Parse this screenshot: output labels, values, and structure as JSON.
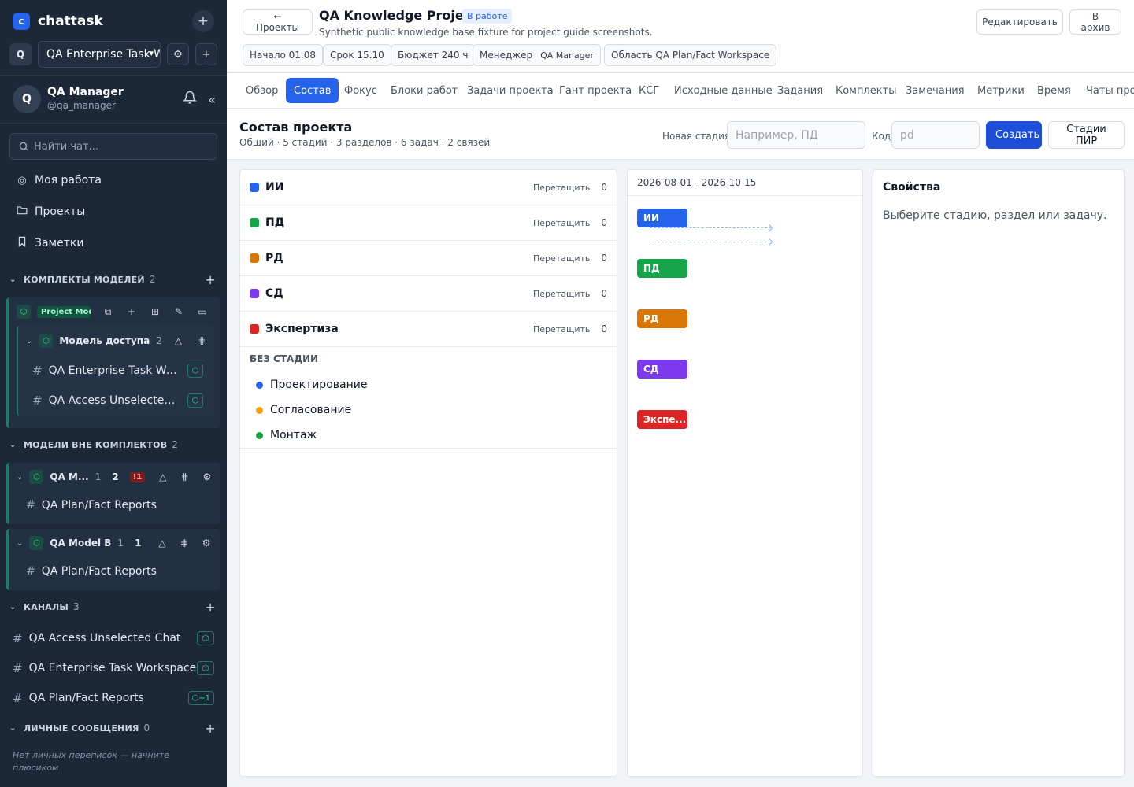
{
  "app": {
    "logo_letter": "c",
    "name": "chattask"
  },
  "workspace": {
    "letter": "Q",
    "selected": "QA Enterprise Task Workspace"
  },
  "user": {
    "initial": "Q",
    "name": "QA Manager",
    "handle": "@qa_manager"
  },
  "search": {
    "placeholder": "Найти чат..."
  },
  "nav": [
    {
      "label": "Моя работа",
      "icon": "target-icon"
    },
    {
      "label": "Проекты",
      "icon": "folder-icon"
    },
    {
      "label": "Заметки",
      "icon": "bookmark-icon"
    }
  ],
  "model_sets": {
    "title": "КОМПЛЕКТЫ МОДЕЛЕЙ",
    "count": "2",
    "set_badge": "Project Models",
    "model": {
      "name": "Модель доступа",
      "count": "2"
    },
    "channels": [
      {
        "label": "QA Enterprise Task Workspace"
      },
      {
        "label": "QA Access Unselected Chat"
      }
    ]
  },
  "models_outside": {
    "title": "МОДЕЛИ ВНЕ КОМПЛЕКТОВ",
    "count": "2",
    "models": [
      {
        "name": "QA M...",
        "n1": "1",
        "n2": "2",
        "warn": "!1",
        "channel": "QA Plan/Fact Reports"
      },
      {
        "name": "QA Model B",
        "n1": "1",
        "n2": "1",
        "warn": "",
        "channel": "QA Plan/Fact Reports"
      }
    ]
  },
  "channels_section": {
    "title": "КАНАЛЫ",
    "count": "3",
    "items": [
      {
        "label": "QA Access Unselected Chat",
        "tag": "⬡"
      },
      {
        "label": "QA Enterprise Task Workspace",
        "tag": "⬡"
      },
      {
        "label": "QA Plan/Fact Reports",
        "tag": "⬡+1"
      }
    ]
  },
  "dm_section": {
    "title": "ЛИЧНЫЕ СООБЩЕНИЯ",
    "count": "0",
    "empty": "Нет личных переписок — начните плюсиком"
  },
  "header": {
    "back": "← Проекты",
    "title": "QA Knowledge Project",
    "status": "В работе",
    "subtitle": "Synthetic public knowledge base fixture for project guide screenshots.",
    "edit": "Редактировать",
    "archive": "В архив",
    "chips": {
      "start": "Начало 01.08",
      "due": "Срок 15.10",
      "budget": "Бюджет 240 ч",
      "manager_label": "Менеджер",
      "manager_value": "QA Manager",
      "area": "Область QA Plan/Fact Workspace"
    }
  },
  "tabs": [
    "Обзор",
    "Состав",
    "Фокус",
    "Блоки работ",
    "Задачи проекта",
    "Гант проекта",
    "КСГ",
    "Исходные данные",
    "Задания",
    "Комплекты",
    "Замечания",
    "Метрики",
    "Время",
    "Чаты проекта"
  ],
  "active_tab": "Состав",
  "composition": {
    "title": "Состав проекта",
    "summary": "Общий · 5 стадий · 3 разделов · 6 задач · 2 связей",
    "new_stage_label": "Новая стадия",
    "new_stage_placeholder": "Например, ПД",
    "code_label": "Код",
    "code_placeholder": "pd",
    "create": "Создать",
    "pir_stages": "Стадии ПИР"
  },
  "stages": [
    {
      "name": "ИИ",
      "color": "#2563eb",
      "drag": "Перетащить",
      "count": "0"
    },
    {
      "name": "ПД",
      "color": "#16a34a",
      "drag": "Перетащить",
      "count": "0"
    },
    {
      "name": "РД",
      "color": "#d97706",
      "drag": "Перетащить",
      "count": "0"
    },
    {
      "name": "СД",
      "color": "#7c3aed",
      "drag": "Перетащить",
      "count": "0"
    },
    {
      "name": "Экспертиза",
      "color": "#dc2626",
      "drag": "Перетащить",
      "count": "0"
    }
  ],
  "no_stage": {
    "title": "БЕЗ СТАДИИ",
    "sections": [
      {
        "name": "Проектирование",
        "color": "#2563eb"
      },
      {
        "name": "Согласование",
        "color": "#f59e0b"
      },
      {
        "name": "Монтаж",
        "color": "#16a34a"
      }
    ]
  },
  "gantt": {
    "range": "2026-08-01 - 2026-10-15",
    "bars": [
      {
        "label": "ИИ",
        "color": "#2563eb"
      },
      {
        "label": "ПД",
        "color": "#16a34a"
      },
      {
        "label": "РД",
        "color": "#d97706"
      },
      {
        "label": "СД",
        "color": "#7c3aed"
      },
      {
        "label": "Экспе...",
        "color": "#dc2626"
      }
    ]
  },
  "properties": {
    "title": "Свойства",
    "hint": "Выберите стадию, раздел или задачу."
  }
}
